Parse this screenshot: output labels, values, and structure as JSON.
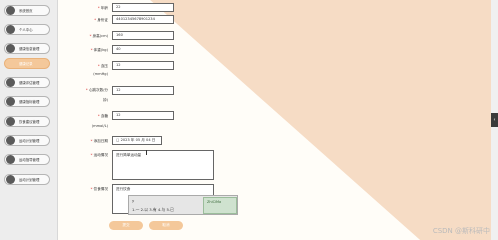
{
  "sidebar": {
    "items": [
      {
        "label": "系统首页"
      },
      {
        "label": "个人中心"
      },
      {
        "label": "健康信息管理"
      },
      {
        "label": "健康记录"
      },
      {
        "label": "健康评估管理"
      },
      {
        "label": "健康指标管理"
      },
      {
        "label": "饮食建议管理"
      },
      {
        "label": "运动计划管理"
      },
      {
        "label": "运动指导管理"
      },
      {
        "label": "运动计划管理"
      }
    ]
  },
  "form": {
    "age": {
      "label": "年龄",
      "value": "22"
    },
    "id_no": {
      "label": "身份证",
      "value": "44012345678901234"
    },
    "height": {
      "label": "身高(cm)",
      "value": "160"
    },
    "weight": {
      "label": "体重(kg)",
      "value": "40"
    },
    "blood_pressure": {
      "label": "血压",
      "unit": "(mmHg)",
      "value": "12"
    },
    "heart_rate": {
      "label": "心跳次数/分",
      "unit": "钟)",
      "value": "12"
    },
    "blood_sugar": {
      "label": "血糖",
      "unit": "(mmol/L)",
      "value": "12"
    },
    "record_date": {
      "label": "添加日期",
      "value": "2023 年 05 月 04 日"
    },
    "exercise": {
      "label": "运动情况",
      "value": "进行简单运动量"
    },
    "diet": {
      "label": "饮食情况",
      "value": "进行饮食"
    }
  },
  "ime": {
    "input": "y",
    "candidates": "1.一  2.以  3.有  4.与  5.已",
    "logo_text": "ZhiCiMa"
  },
  "buttons": {
    "submit": "提交",
    "cancel": "取消"
  },
  "watermark": "CSDN @斯科研中"
}
